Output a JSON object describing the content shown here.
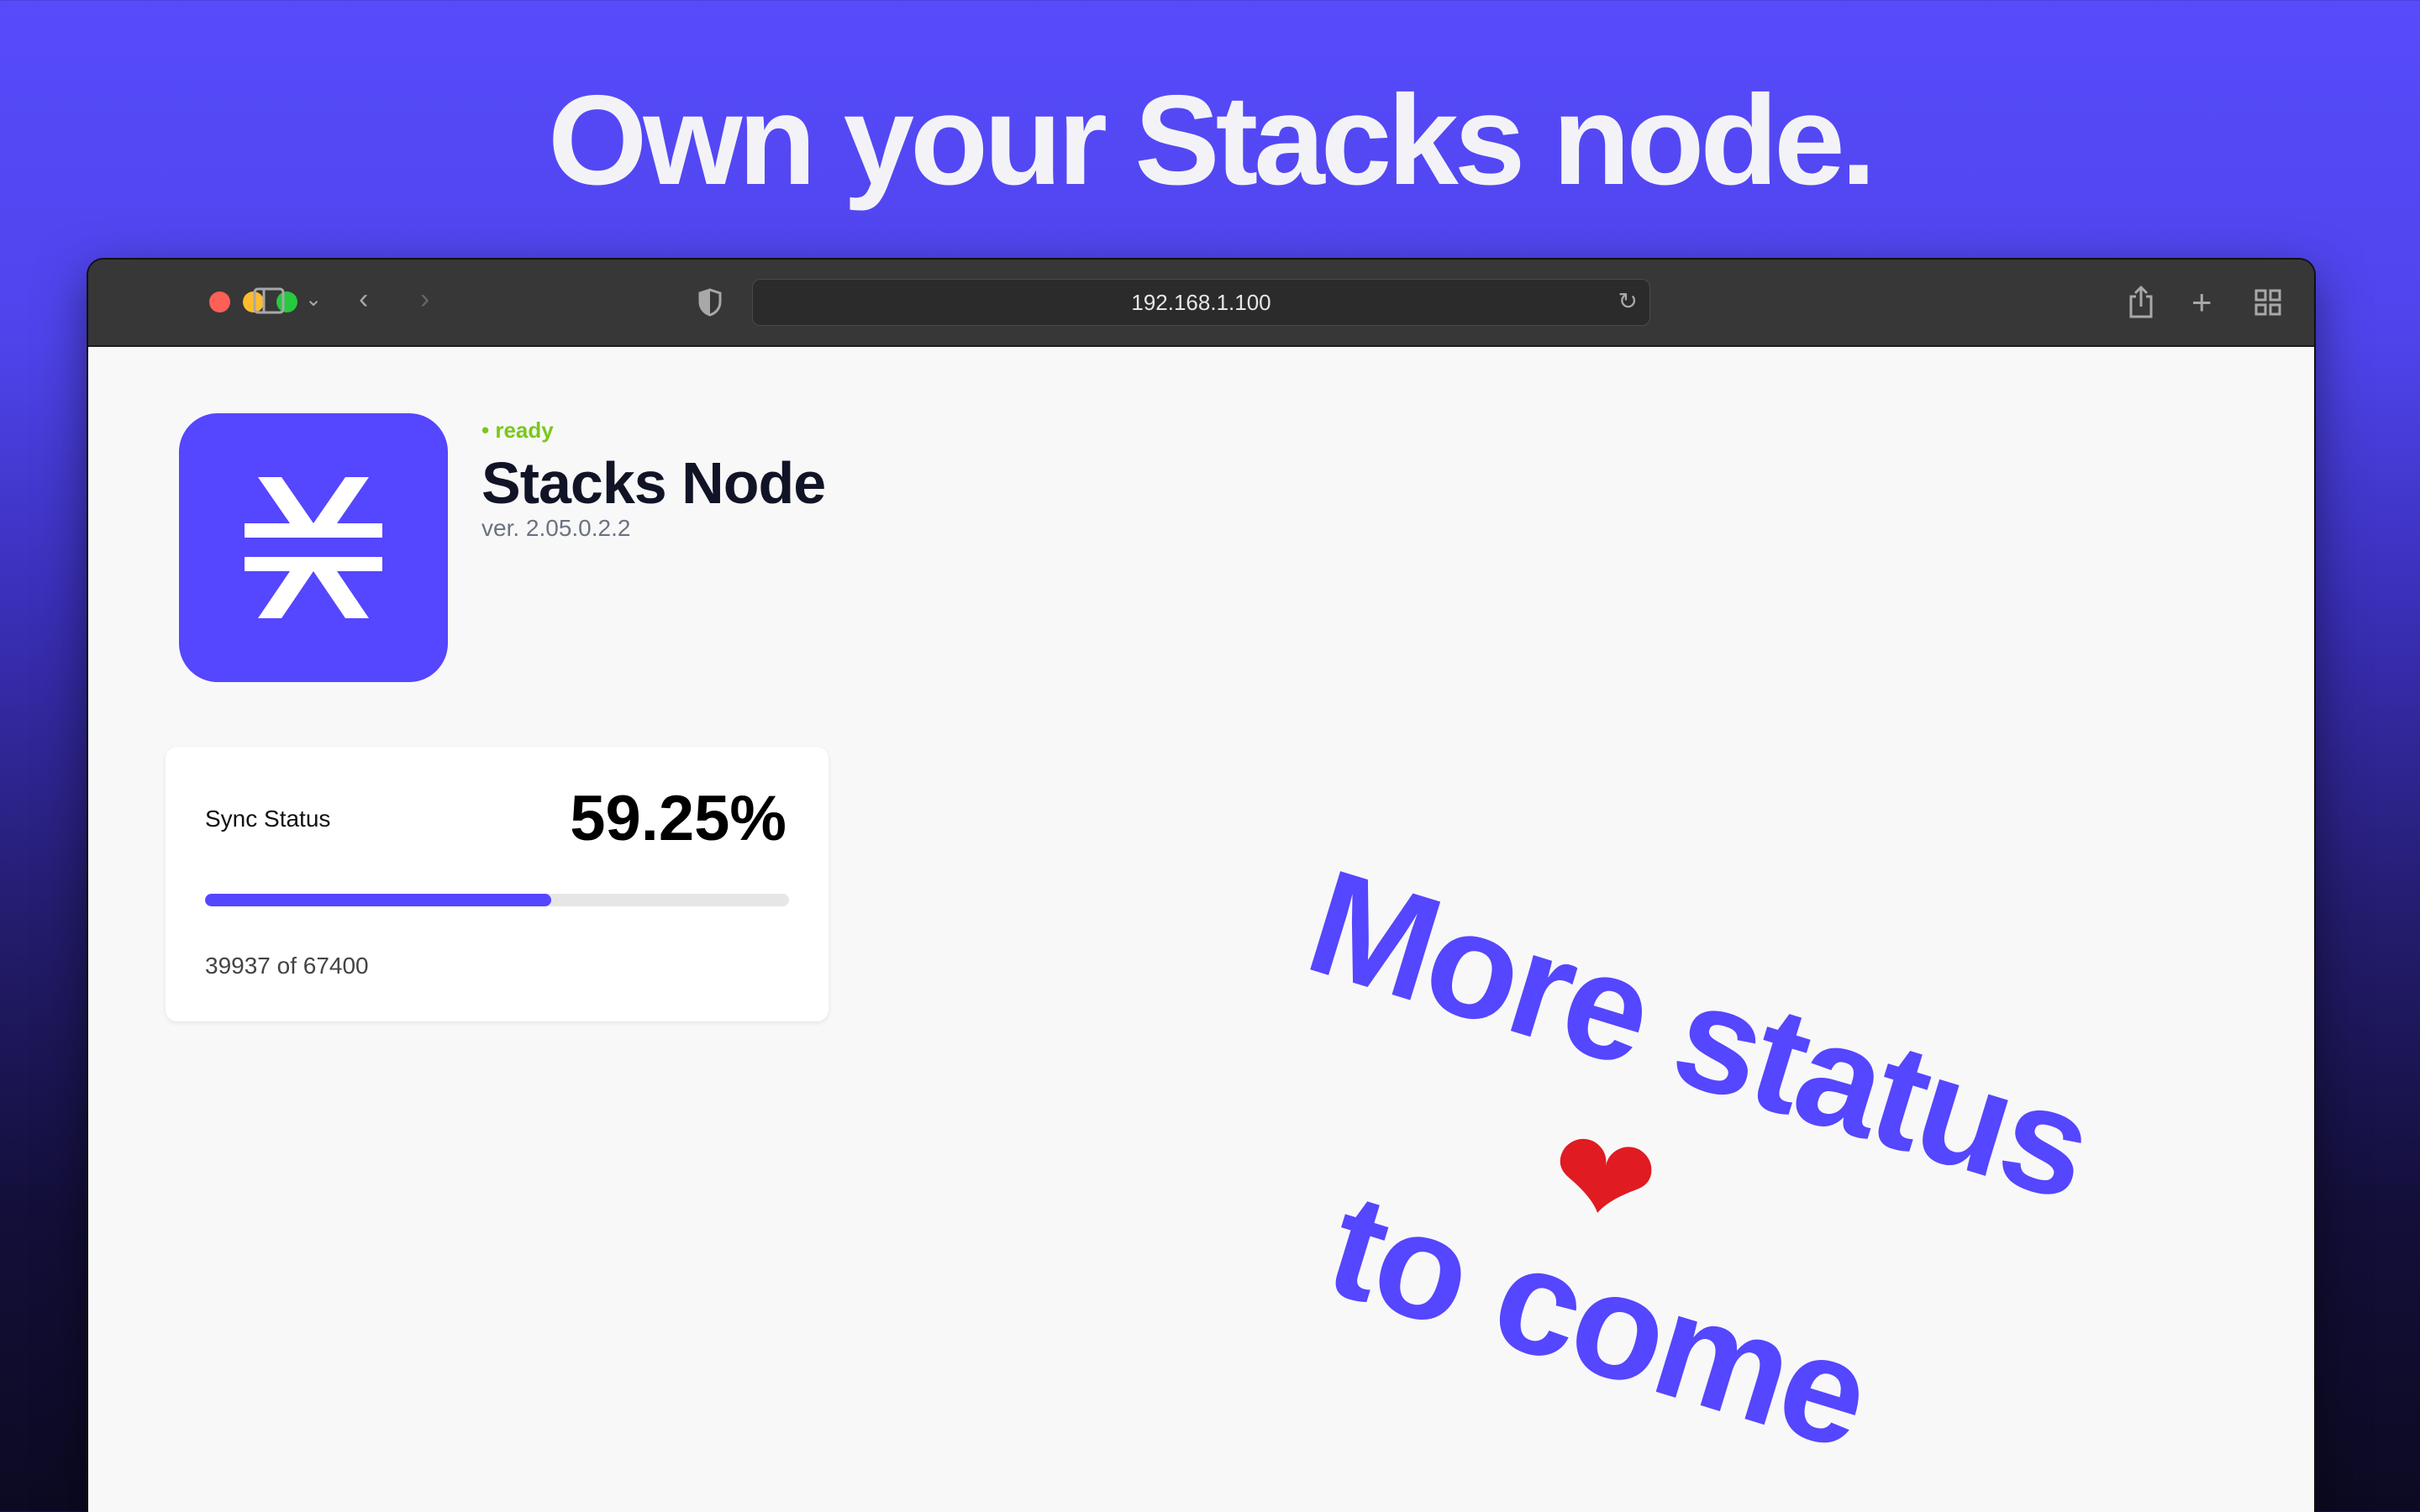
{
  "headline": "Own your Stacks node.",
  "browser": {
    "url": "192.168.1.100"
  },
  "node": {
    "status": "• ready",
    "title": "Stacks Node",
    "version": "ver. 2.05.0.2.2",
    "status_color": "#7ac71c",
    "brand_color": "#5546ff"
  },
  "sync": {
    "label": "Sync Status",
    "percent_text": "59.25%",
    "progress_percent": 59.25,
    "blocks_text": "39937 of 67400"
  },
  "promo": {
    "line1": "More status",
    "heart": "❤",
    "line2": "to come"
  }
}
